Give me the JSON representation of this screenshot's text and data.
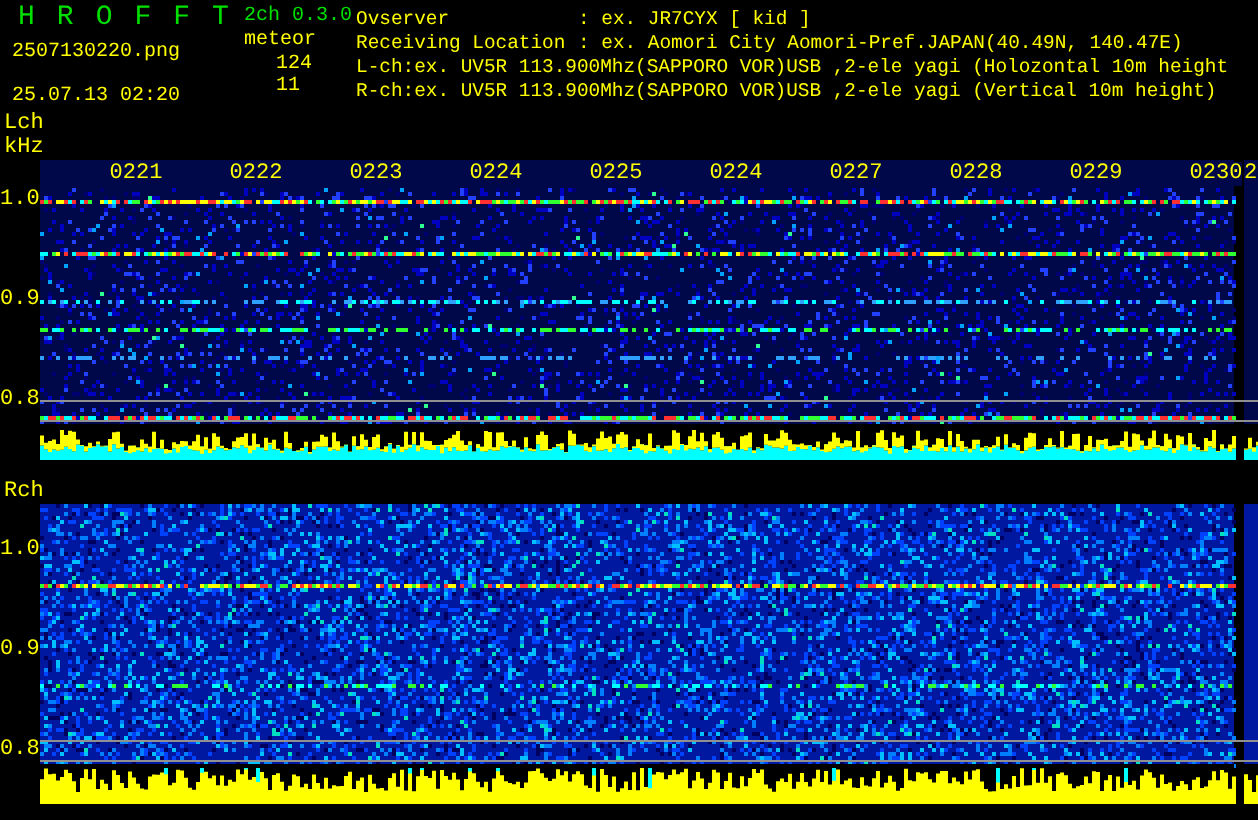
{
  "app": {
    "title_letters": [
      "H",
      "R",
      "O",
      "F",
      "F",
      "T"
    ],
    "version": "2ch 0.3.0",
    "file_name": "2507130220.png",
    "date_time": "25.07.13 02:20",
    "meteor_label": "meteor",
    "meteor_counts": [
      "124",
      "11"
    ]
  },
  "info": [
    {
      "label": "Ovserver",
      "value": ": ex. JR7CYX [ kid ]"
    },
    {
      "label": "Receiving Location",
      "value": ": ex. Aomori City Aomori-Pref.JAPAN(40.49N, 140.47E)"
    }
  ],
  "channel_lines": [
    "L-ch:ex. UV5R 113.900Mhz(SAPPORO VOR)USB ,2-ele yagi (Holozontal 10m height",
    "R-ch:ex. UV5R 113.900Mhz(SAPPORO VOR)USB ,2-ele yagi (Vertical 10m height)"
  ],
  "panels": [
    {
      "channel": "Lch",
      "unit": "kHz",
      "freq_labels": [
        "1.0",
        "0.9",
        "0.8"
      ],
      "time_labels": [
        "0221",
        "0222",
        "0223",
        "0224",
        "0225",
        "0224",
        "0227",
        "0228",
        "0229",
        "0230"
      ],
      "next_time_label": "2"
    },
    {
      "channel": "Rch",
      "freq_labels": [
        "1.0",
        "0.9",
        "0.8"
      ]
    }
  ]
}
